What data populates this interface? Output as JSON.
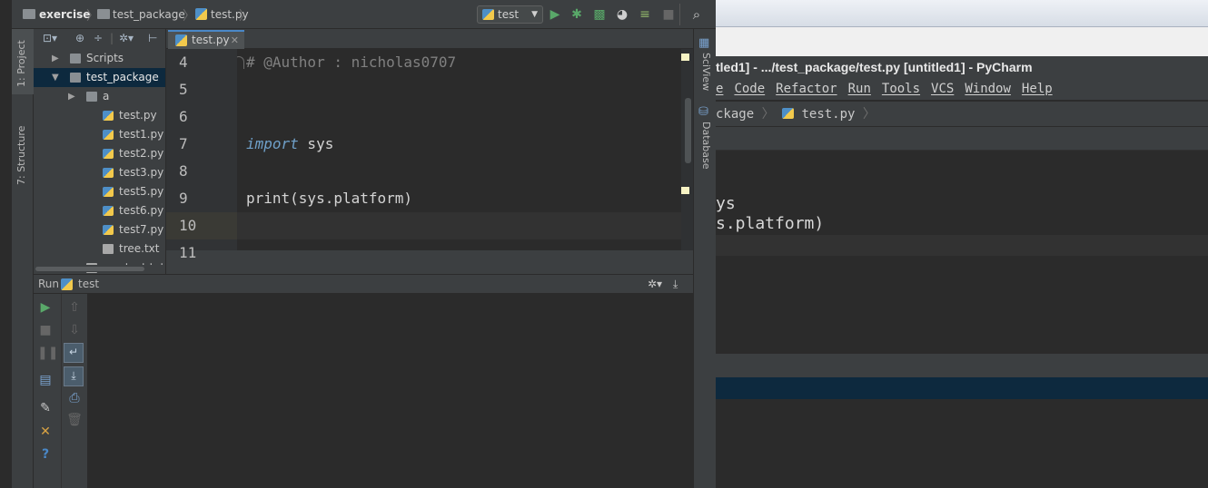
{
  "main": {
    "breadcrumb": {
      "project": "exercise",
      "package": "test_package",
      "file": "test.py"
    },
    "run_config": "test",
    "left_tabs": {
      "project": "1: Project",
      "structure": "7: Structure"
    },
    "right_tabs": {
      "sciview": "SciView",
      "database": "Database"
    },
    "project_tree": [
      {
        "label": "Scripts",
        "kind": "folder",
        "indent": 1,
        "arrow": "▶",
        "selected": false
      },
      {
        "label": "test_package",
        "kind": "folder",
        "indent": 1,
        "arrow": "▼",
        "selected": true
      },
      {
        "label": "a",
        "kind": "folder",
        "indent": 2,
        "arrow": "▶",
        "selected": false
      },
      {
        "label": "test.py",
        "kind": "py",
        "indent": 3,
        "arrow": "",
        "selected": false
      },
      {
        "label": "test1.py",
        "kind": "py",
        "indent": 3,
        "arrow": "",
        "selected": false
      },
      {
        "label": "test2.py",
        "kind": "py",
        "indent": 3,
        "arrow": "",
        "selected": false
      },
      {
        "label": "test3.py",
        "kind": "py",
        "indent": 3,
        "arrow": "",
        "selected": false
      },
      {
        "label": "test5.py",
        "kind": "py",
        "indent": 3,
        "arrow": "",
        "selected": false
      },
      {
        "label": "test6.py",
        "kind": "py",
        "indent": 3,
        "arrow": "",
        "selected": false
      },
      {
        "label": "test7.py",
        "kind": "py",
        "indent": 3,
        "arrow": "",
        "selected": false
      },
      {
        "label": "tree.txt",
        "kind": "txt",
        "indent": 3,
        "arrow": "",
        "selected": false
      },
      {
        "label": "newtest.txt",
        "kind": "txt",
        "indent": 2,
        "arrow": "",
        "selected": false
      }
    ],
    "editor_tab": "test.py",
    "code_lines": [
      {
        "num": "4",
        "html_kind": "comment",
        "text": "# @Author  : nicholas0707",
        "current": false
      },
      {
        "num": "5",
        "html_kind": "plain",
        "text": "",
        "current": false
      },
      {
        "num": "6",
        "html_kind": "plain",
        "text": "",
        "current": false
      },
      {
        "num": "7",
        "html_kind": "import",
        "kw": "import",
        "rest": " sys",
        "current": false
      },
      {
        "num": "8",
        "html_kind": "plain",
        "text": "",
        "current": false
      },
      {
        "num": "9",
        "html_kind": "plain",
        "text": "print(sys.platform)",
        "current": false
      },
      {
        "num": "10",
        "html_kind": "plain",
        "text": "",
        "current": true
      },
      {
        "num": "11",
        "html_kind": "plain",
        "text": "",
        "current": false
      }
    ],
    "run_panel": {
      "label": "Run",
      "config": "test"
    }
  },
  "background_window": {
    "title": "tled1] - .../test_package/test.py [untitled1] - PyCharm",
    "menu": [
      "e",
      "Code",
      "Refactor",
      "Run",
      "Tools",
      "VCS",
      "Window",
      "Help"
    ],
    "breadcrumb_partial": "ckage",
    "breadcrumb_file": "test.py",
    "code_fragments": [
      "ys",
      "s.platform)"
    ]
  }
}
